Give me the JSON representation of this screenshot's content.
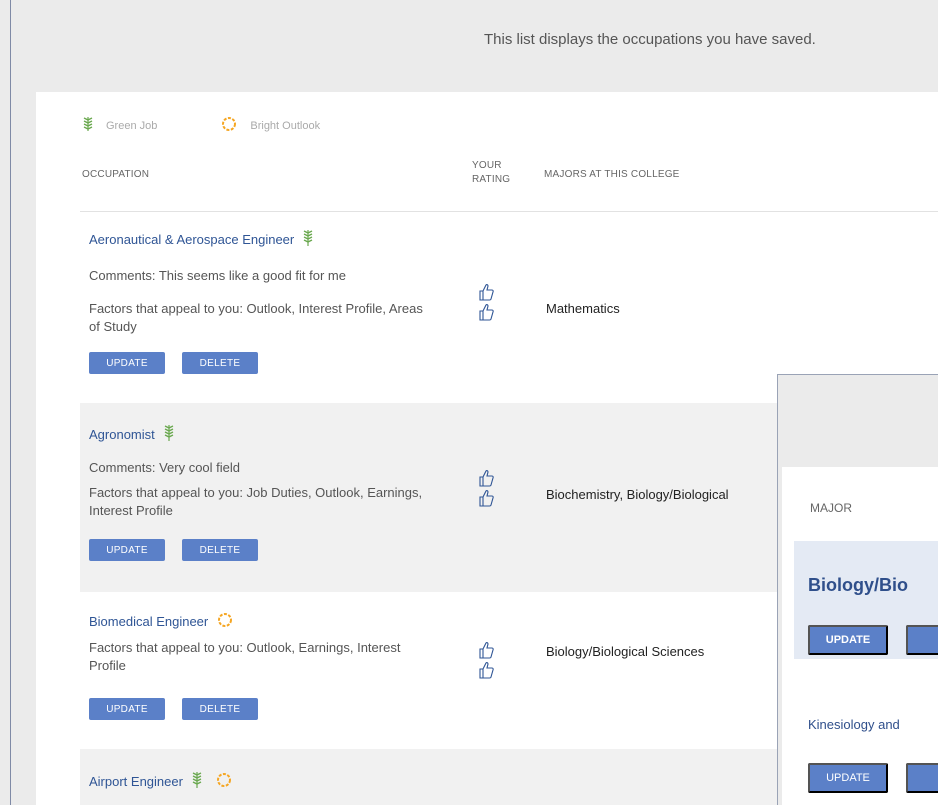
{
  "intro_text": "This list displays the occupations you have saved.",
  "legend": {
    "green_job": "Green Job",
    "bright_outlook": "Bright Outlook"
  },
  "headers": {
    "occupation": "OCCUPATION",
    "rating_line1": "YOUR",
    "rating_line2": "RATING",
    "majors": "MAJORS AT THIS COLLEGE"
  },
  "buttons": {
    "update": "UPDATE",
    "delete": "DELETE"
  },
  "occupations": [
    {
      "title": "Aeronautical & Aerospace Engineer",
      "icons": [
        "green-job"
      ],
      "comments": "Comments: This seems like a good fit for me",
      "factors": "Factors that appeal to you: Outlook, Interest Profile, Areas of Study",
      "rating": "2 thumbs up",
      "majors": "Mathematics"
    },
    {
      "title": "Agronomist",
      "icons": [
        "green-job"
      ],
      "comments": "Comments: Very cool field",
      "factors": "Factors that appeal to you: Job Duties, Outlook, Earnings, Interest Profile",
      "rating": "2 thumbs up",
      "majors": "Biochemistry, Biology/Biological"
    },
    {
      "title": "Biomedical Engineer",
      "icons": [
        "bright-outlook"
      ],
      "factors": "Factors that appeal to you: Outlook, Earnings, Interest Profile",
      "rating": "2 thumbs up",
      "majors": "Biology/Biological Sciences"
    },
    {
      "title": "Airport Engineer",
      "icons": [
        "green-job",
        "bright-outlook"
      ]
    }
  ],
  "overlay": {
    "header": "MAJOR",
    "highlight_title": "Biology/Bio",
    "update": "UPDATE",
    "second_item": "Kinesiology and"
  },
  "colors": {
    "link": "#2f5595",
    "button": "#5b80c8",
    "green_icon": "#6aa84f",
    "orange_icon": "#f5a623"
  }
}
